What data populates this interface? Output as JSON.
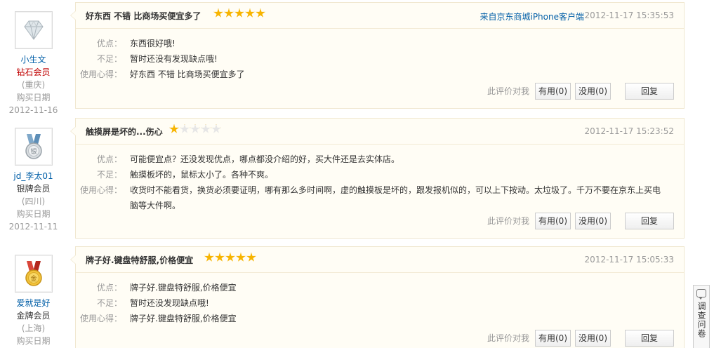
{
  "common": {
    "feedback_hint": "此评价对我",
    "reply_label": "回复",
    "pros_label": "优点：",
    "cons_label": "不足：",
    "experience_label": "使用心得："
  },
  "reviews": [
    {
      "user": {
        "name": "小生文",
        "level": "钻石会员",
        "location": "(重庆)",
        "purchase_label": "购买日期",
        "purchase_date": "2012-11-16",
        "avatar_icon": "diamond-icon"
      },
      "title": "好东西 不错 比商场买便宜多了",
      "rating": 5,
      "source": "来自京东商城iPhone客户端",
      "time": "2012-11-17 15:35:53",
      "pros": "东西很好哦!",
      "cons": "暂时还没有发现缺点哦!",
      "experience": "好东西 不错 比商场买便宜多了",
      "useful_label": "有用(0)",
      "useless_label": "没用(0)"
    },
    {
      "user": {
        "name": "jd_李太01",
        "level": "银牌会员",
        "location": "(四川)",
        "purchase_label": "购买日期",
        "purchase_date": "2012-11-11",
        "avatar_icon": "silver-medal-icon"
      },
      "title": "触摸屏是坏的...伤心",
      "rating": 1,
      "time": "2012-11-17 15:23:52",
      "pros": "可能便宜点？还没发现优点，哪点都没介绍的好，买大件还是去实体店。",
      "cons": "触摸板坏的，鼠标太小了。各种不爽。",
      "experience": "收货时不能看货，换货必须要证明，哪有那么多时间啊，虚的触摸板是坏的，跟发报机似的，可以上下按动。太垃圾了。千万不要在京东上买电脑等大件啊。",
      "useful_label": "有用(0)",
      "useless_label": "没用(0)"
    },
    {
      "user": {
        "name": "爱就是好",
        "level": "金牌会员",
        "location": "(上海)",
        "purchase_label": "购买日期",
        "avatar_icon": "gold-medal-icon"
      },
      "title": "牌子好.键盘特舒服,价格便宜",
      "rating": 5,
      "time": "2012-11-17 15:05:33",
      "pros": "牌子好.键盘特舒服,价格便宜",
      "cons": "暂时还没发现缺点哦!",
      "experience": "牌子好.键盘特舒服,价格便宜",
      "useful_label": "有用(0)",
      "useless_label": "没用(0)"
    }
  ],
  "survey": {
    "label": "调查问卷",
    "icon": "speech-bubble-icon"
  },
  "colors": {
    "link": "#005ea7",
    "diamond_level": "#c00000",
    "star": "#f7b400",
    "card_bg": "#fffdf5"
  }
}
